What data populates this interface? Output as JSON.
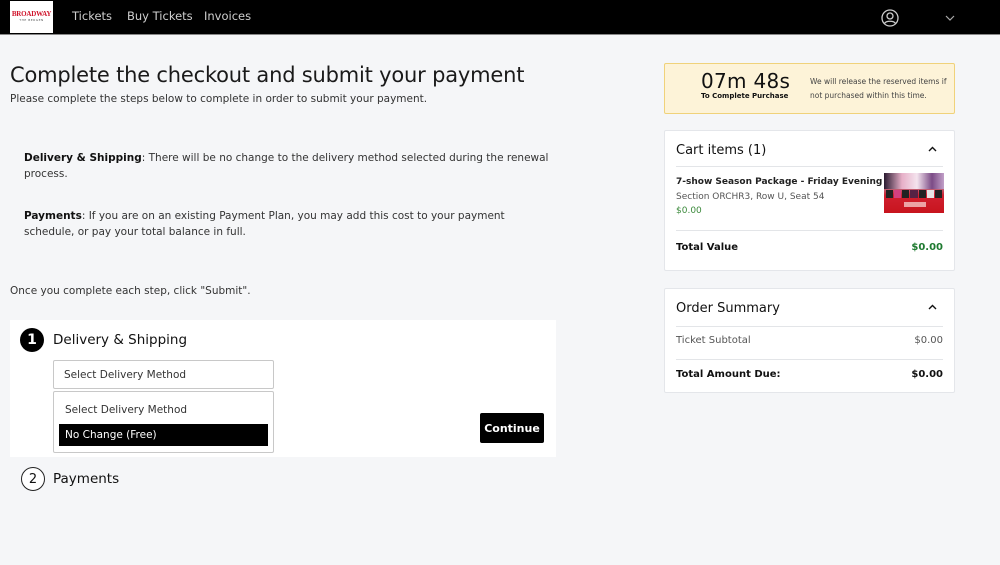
{
  "nav": {
    "logo_line1": "BROADWAY",
    "logo_line2": "THE BERGEN",
    "links": [
      "Tickets",
      "Buy Tickets",
      "Invoices"
    ],
    "user_icon": "user-circle-icon",
    "menu_icon": "chevron-down-icon"
  },
  "main": {
    "title": "Complete the checkout and submit your payment",
    "subtitle": "Please complete the steps below to complete in order to submit your payment.",
    "info": [
      {
        "label": "Delivery & Shipping",
        "text": ": There will be no change to the delivery method selected during the renewal process."
      },
      {
        "label": "Payments",
        "text": ": If you are on an existing Payment Plan, you may add this cost to your payment schedule, or pay your total balance in full."
      }
    ],
    "instruction": "Once you complete each step, click \"Submit\".",
    "steps": [
      {
        "number": "1",
        "title": "Delivery & Shipping",
        "select": {
          "value": "Select Delivery Method",
          "options": [
            "Select Delivery Method",
            "No Change (Free)"
          ],
          "highlighted": "No Change (Free)"
        },
        "continue_label": "Continue"
      },
      {
        "number": "2",
        "title": "Payments"
      }
    ]
  },
  "timer": {
    "value": "07m 48s",
    "label": "To Complete Purchase",
    "note": "We will release the reserved items if not purchased within this time."
  },
  "cart": {
    "title": "Cart items (1)",
    "items": [
      {
        "name": "7-show Season Package - Friday Evening",
        "seat": "Section ORCHR3, Row U, Seat 54",
        "price": "$0.00"
      }
    ],
    "total_label": "Total Value",
    "total_value": "$0.00"
  },
  "summary": {
    "title": "Order Summary",
    "subtotal_label": "Ticket Subtotal",
    "subtotal_value": "$0.00",
    "due_label": "Total Amount Due:",
    "due_value": "$0.00"
  },
  "colors": {
    "nav_bg": "#000000",
    "timer_bg": "#fdf3d8",
    "price_green": "#1e7a30",
    "button_bg": "#000000"
  }
}
